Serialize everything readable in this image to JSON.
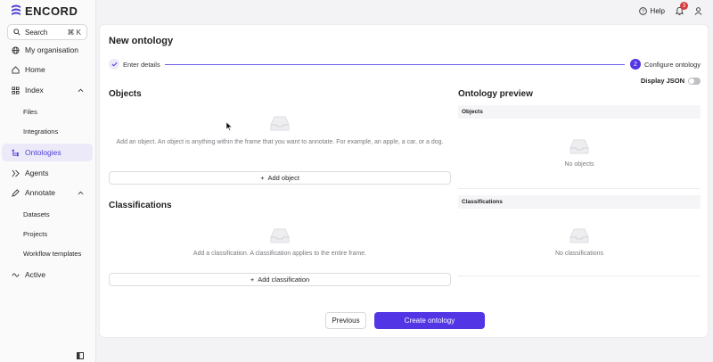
{
  "app": {
    "logo_text": "ENCORD"
  },
  "search": {
    "label": "Search",
    "shortcut": "⌘ K"
  },
  "sidebar": {
    "items": [
      {
        "label": "My organisation",
        "icon": "globe-icon"
      },
      {
        "label": "Home",
        "icon": "home-icon"
      },
      {
        "label": "Index",
        "icon": "grid-icon"
      },
      {
        "label": "Files"
      },
      {
        "label": "Integrations"
      },
      {
        "label": "Ontologies",
        "icon": "ontology-icon"
      },
      {
        "label": "Agents",
        "icon": "agents-icon"
      },
      {
        "label": "Annotate",
        "icon": "annotate-icon"
      },
      {
        "label": "Datasets"
      },
      {
        "label": "Projects"
      },
      {
        "label": "Workflow templates"
      },
      {
        "label": "Active",
        "icon": "active-icon"
      }
    ]
  },
  "topbar": {
    "help_label": "Help",
    "notification_count": "3"
  },
  "page": {
    "title": "New ontology",
    "steps": [
      {
        "number": "✓",
        "label": "Enter details"
      },
      {
        "number": "2",
        "label": "Configure ontology"
      }
    ],
    "display_json_label": "Display JSON"
  },
  "objects": {
    "title": "Objects",
    "empty_text": "Add an object. An object is anything within the frame that you want to annotate. For example, an apple, a car, or a dog.",
    "add_label": "Add object"
  },
  "classifications": {
    "title": "Classifications",
    "empty_text": "Add a classification. A classification applies to the entire frame.",
    "add_label": "Add classification"
  },
  "preview": {
    "title": "Ontology preview",
    "objects_header": "Objects",
    "objects_empty": "No objects",
    "classifications_header": "Classifications",
    "classifications_empty": "No classifications"
  },
  "footer": {
    "previous_label": "Previous",
    "create_label": "Create ontology"
  },
  "colors": {
    "accent": "#5236e6",
    "active_bg": "#eceaf9",
    "badge": "#d63d3d"
  }
}
